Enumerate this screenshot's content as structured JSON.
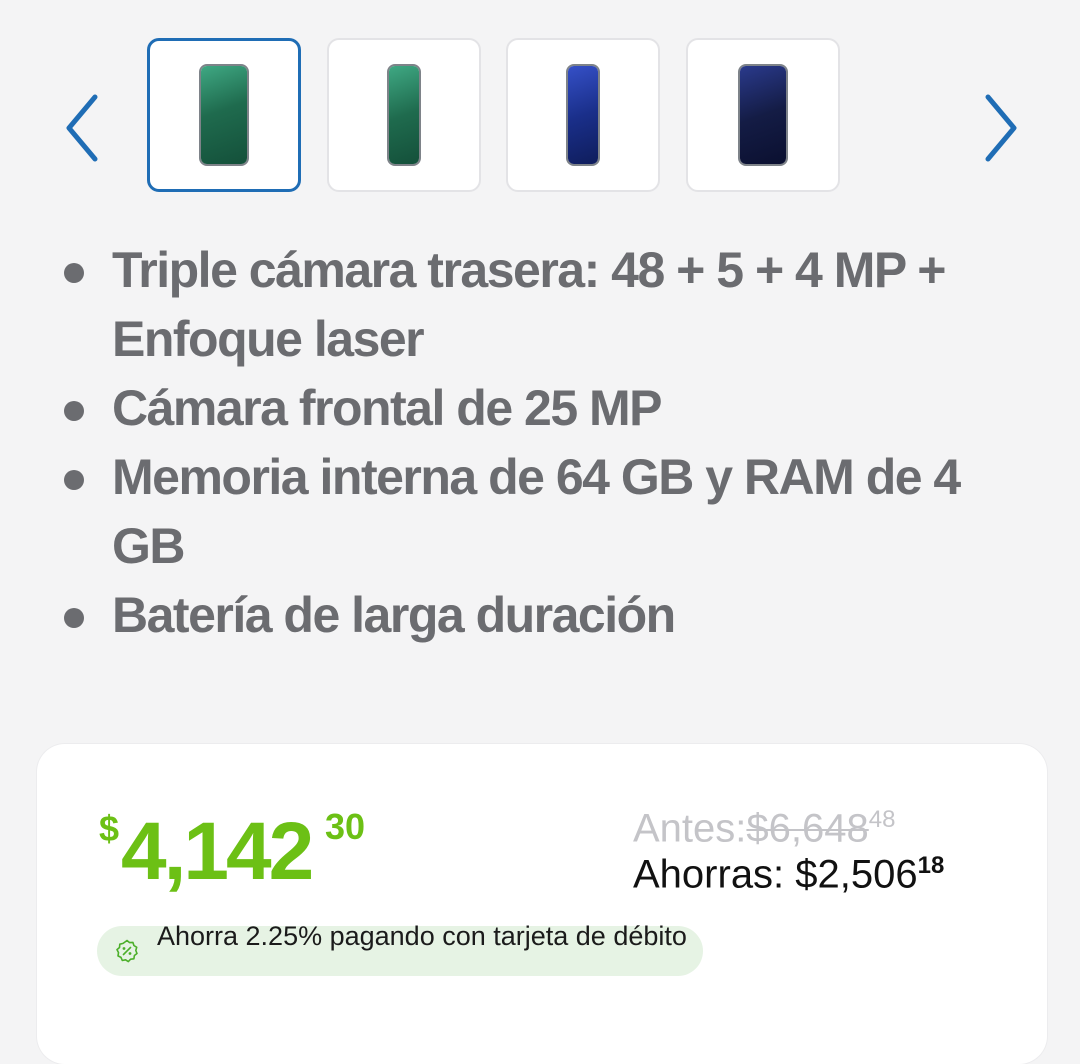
{
  "carousel": {
    "prev_icon": "chevron-left-icon",
    "next_icon": "chevron-right-icon",
    "thumbnails": [
      {
        "color": "#1f6b4e",
        "accent": "#3fa883",
        "selected": true
      },
      {
        "color": "#1f6b4e",
        "accent": "#3fa883",
        "selected": false
      },
      {
        "color": "#1a2f8a",
        "accent": "#3550c7",
        "selected": false
      },
      {
        "color": "#141c45",
        "accent": "#2a3a8c",
        "selected": false
      }
    ]
  },
  "features": [
    "Triple cámara trasera: 48 + 5 + 4 MP + Enfoque laser",
    "Cámara frontal de 25 MP",
    "Memoria interna de 64 GB y RAM de 4 GB",
    "Batería de larga duración"
  ],
  "price": {
    "currency_symbol": "$",
    "integer": "4,142",
    "cents": "30",
    "before_label": "Antes:",
    "before_value": "$6,648",
    "before_cents": "48",
    "savings_label": "Ahorras: $2,506",
    "savings_cents": "18",
    "promo_text": "Ahorra 2.25% pagando con tarjeta de débito",
    "promo_icon": "discount-badge-icon"
  },
  "colors": {
    "accent_blue": "#1f6db5",
    "price_green": "#6cc015",
    "text_gray": "#6b6c70",
    "promo_bg": "#e6f3e4"
  }
}
